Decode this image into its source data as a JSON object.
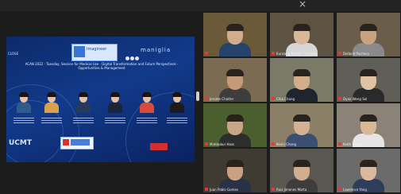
{
  "window": {
    "close_glyph": "×"
  },
  "presentation": {
    "logo_text": "Imagineer",
    "logo2_text": "maniglia",
    "left_tag": "CLOSE",
    "title": "ACAN 2022 · Tuesday, Session for Medical Use · Digital Transformation and Future Perspectives · Opportunities & Management",
    "bottom_text": "UCMT",
    "portrait_colors": [
      "#2f5d8a",
      "#d9a24a",
      "#263a5c",
      "#1c2437",
      "#d94a3b",
      "#1b1b1b"
    ]
  },
  "participants": [
    {
      "name": "",
      "wall": "#6b5a3a",
      "shirt": "#26446a",
      "face": "#d2ad8d"
    },
    {
      "name": "Eunsang Matsu — Jaewon",
      "wall": "#5c5343",
      "shirt": "#d6d6d6",
      "face": "#d9b898"
    },
    {
      "name": "Dolland Pacheco",
      "wall": "#6a5e4a",
      "shirt": "#8a8a8a",
      "face": "#caa37e"
    },
    {
      "name": "Jerome Chatter",
      "wall": "#7a6b52",
      "shirt": "#3d3d3d",
      "face": "#c59a78"
    },
    {
      "name": "Chia Chang",
      "wall": "#7b7a68",
      "shirt": "#1f2430",
      "face": "#d3ad8a"
    },
    {
      "name": "Dyan Weng Sol",
      "wall": "#5f5e57",
      "shirt": "#2a2a2a",
      "face": "#e1c2a3"
    },
    {
      "name": "Mahbubur Hoss",
      "wall": "#4b5e2d",
      "shirt": "#2d2d2d",
      "face": "#caa585"
    },
    {
      "name": "Kevin Chong",
      "wall": "#8c7f68",
      "shirt": "#3b4f73",
      "face": "#d4b191"
    },
    {
      "name": "Keith Young",
      "wall": "#8b8377",
      "shirt": "#e5e5e5",
      "face": "#d9b797"
    },
    {
      "name": "Juan Pablo Gomes",
      "wall": "#3f3a32",
      "shirt": "#273246",
      "face": "#c9a182"
    },
    {
      "name": "Ruiz Jimenes Marta",
      "wall": "#5a5751",
      "shirt": "#3d3d3d",
      "face": "#d0ad8d"
    },
    {
      "name": "Lawrence Yang",
      "wall": "#6b6b6b",
      "shirt": "#2f3d5c",
      "face": "#dab9a0"
    }
  ]
}
